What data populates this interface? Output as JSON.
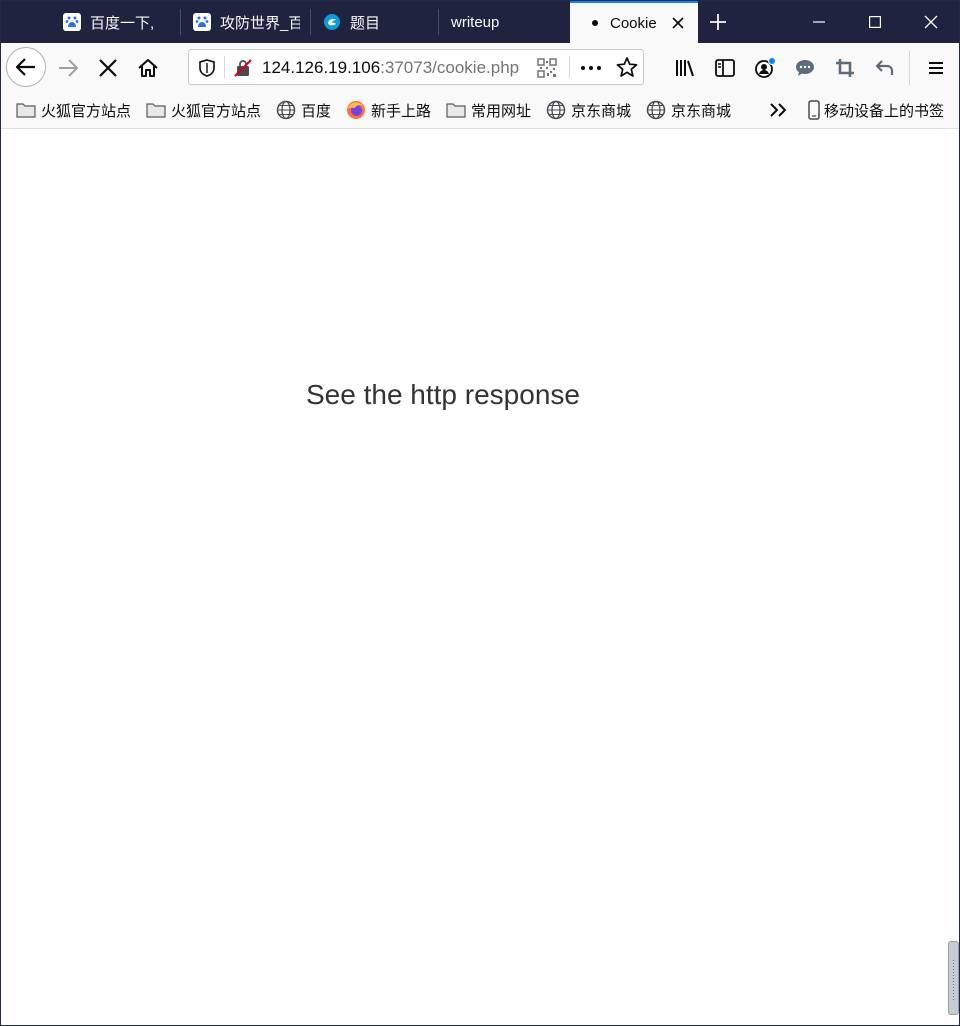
{
  "browser": {
    "tabs": [
      {
        "title": "百度一下,",
        "favicon": "baidu-paw-icon"
      },
      {
        "title": "攻防世界_百",
        "favicon": "baidu-paw-icon"
      },
      {
        "title": "题目",
        "favicon": "adworld-logo-icon"
      },
      {
        "title": "writeup",
        "favicon": ""
      },
      {
        "title": "Cookie",
        "favicon": "loading-dot-icon",
        "selected": true
      }
    ],
    "url": {
      "host": "124.126.19.106",
      "rest": ":37073/cookie.php"
    },
    "bookmarks": [
      {
        "label": "火狐官方站点",
        "icon": "folder-icon"
      },
      {
        "label": "火狐官方站点",
        "icon": "folder-icon"
      },
      {
        "label": "百度",
        "icon": "globe-icon"
      },
      {
        "label": "新手上路",
        "icon": "firefox-icon"
      },
      {
        "label": "常用网址",
        "icon": "folder-icon"
      },
      {
        "label": "京东商城",
        "icon": "globe-icon"
      },
      {
        "label": "京东商城",
        "icon": "globe-icon"
      }
    ],
    "mobile_bookmarks": {
      "label": "移动设备上的书签",
      "icon": "mobile-device-icon"
    },
    "colors": {
      "accent": "#0a84ff",
      "tabstrip": "#202340"
    }
  },
  "page": {
    "message": "See the http response"
  }
}
